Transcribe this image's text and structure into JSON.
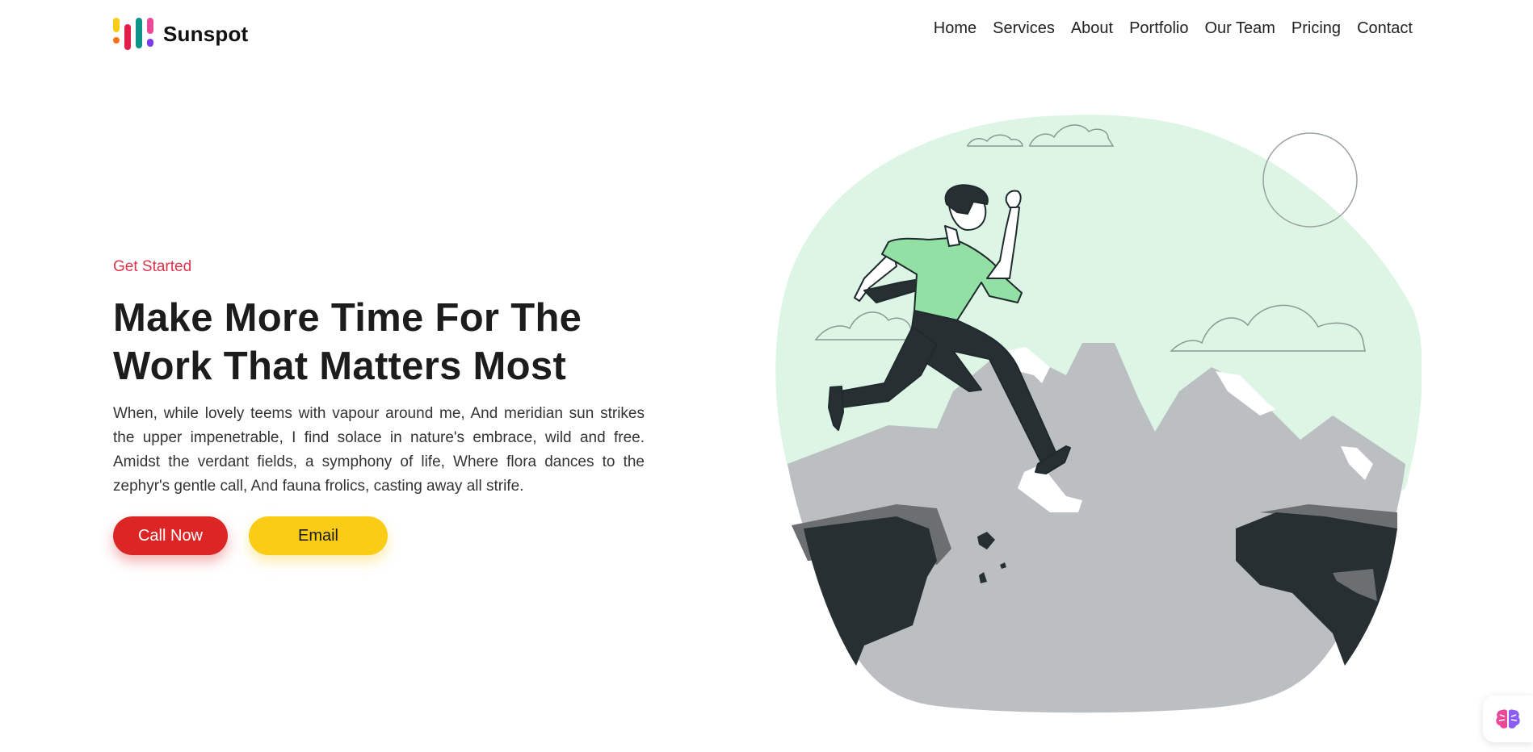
{
  "brand": {
    "name": "Sunspot",
    "logo_colors": [
      "#facc15",
      "#f97316",
      "#e11d48",
      "#0d9488",
      "#ec4899",
      "#7c3aed"
    ]
  },
  "nav": {
    "items": [
      {
        "label": "Home"
      },
      {
        "label": "Services"
      },
      {
        "label": "About"
      },
      {
        "label": "Portfolio"
      },
      {
        "label": "Our Team"
      },
      {
        "label": "Pricing"
      },
      {
        "label": "Contact"
      }
    ]
  },
  "hero": {
    "eyebrow": "Get Started",
    "headline_line1": "Make More Time For The",
    "headline_line2": "Work That Matters Most",
    "body": "When, while lovely teems with vapour around me, And meridian sun strikes the upper impenetrable, I find solace in nature's embrace, wild and free. Amidst the verdant fields, a symphony of life, Where flora dances to the zephyr's gentle call, And fauna frolics, casting away all strife.",
    "call_label": "Call Now",
    "email_label": "Email"
  },
  "illustration": {
    "subject": "man leaping across a mountain gap",
    "colors": {
      "sky": "#ddf5e4",
      "rock_light": "#bcbfc2",
      "rock_dark": "#272f33",
      "rock_mid": "#6b6f72",
      "shirt": "#93e0a5",
      "line": "#1f2a2e"
    }
  },
  "assistant": {
    "icon": "brain-icon"
  },
  "colors": {
    "accent_red": "#dc2626",
    "accent_yellow": "#facc15",
    "eyebrow": "#e0334b"
  }
}
